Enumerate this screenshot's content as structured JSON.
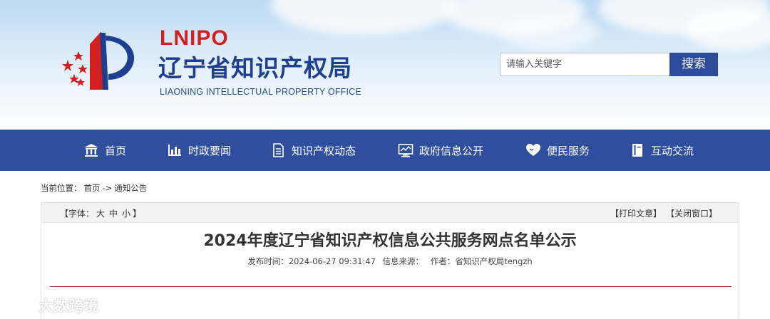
{
  "header": {
    "brand_abbr": "LNIPO",
    "brand_name": "辽宁省知识产权局",
    "brand_en": "LIAONING INTELLECTUAL PROPERTY OFFICE",
    "colors": {
      "brand_red": "#d21f1f",
      "brand_blue": "#1e3f8f",
      "nav_blue": "#2f4f9e"
    }
  },
  "search": {
    "placeholder": "请输入关键字",
    "button_label": "搜索"
  },
  "nav": {
    "items": [
      {
        "label": "首页",
        "icon": "bank-icon"
      },
      {
        "label": "时政要闻",
        "icon": "bar-chart-icon"
      },
      {
        "label": "知识产权动态",
        "icon": "document-icon"
      },
      {
        "label": "政府信息公开",
        "icon": "monitor-icon"
      },
      {
        "label": "便民服务",
        "icon": "heart-icon"
      },
      {
        "label": "互动交流",
        "icon": "book-icon"
      }
    ]
  },
  "breadcrumb": {
    "prefix": "当前位置：",
    "home": "首页",
    "separator": "->",
    "current": "通知公告"
  },
  "toolbar": {
    "font_label": "【字体：",
    "font_large": "大",
    "font_medium": "中",
    "font_small": "小",
    "font_close": "】",
    "print": "【打印文章】",
    "close_window": "【关闭窗口】"
  },
  "article": {
    "title": "2024年度辽宁省知识产权信息公共服务网点名单公示",
    "publish_time": "发布时间：2024-06-27 09:31:47",
    "source": "信息来源：",
    "author": "作者：省知识产权局tengzh"
  },
  "watermark": {
    "text": "大数跨境",
    "icon": "watermark-logo-icon"
  }
}
